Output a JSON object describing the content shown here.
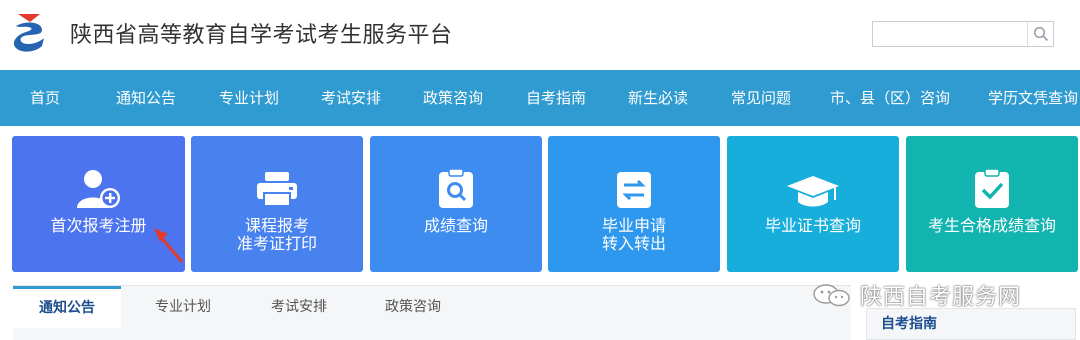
{
  "header": {
    "site_title": "陕西省高等教育自学考试考生服务平台",
    "search_placeholder": "",
    "search_icon": "search-icon"
  },
  "nav": {
    "items": [
      "首页",
      "通知公告",
      "专业计划",
      "考试安排",
      "政策咨询",
      "自考指南",
      "新生必读",
      "常见问题",
      "市、县（区）咨询",
      "学历文凭查询"
    ]
  },
  "tiles": [
    {
      "line1": "首次报考注册",
      "line2": "",
      "icon": "user-add-icon",
      "color": "#4d74ef"
    },
    {
      "line1": "课程报考",
      "line2": "准考证打印",
      "icon": "printer-icon",
      "color": "#4782ef"
    },
    {
      "line1": "成绩查询",
      "line2": "",
      "icon": "search-document-icon",
      "color": "#3f8cf0"
    },
    {
      "line1": "毕业申请",
      "line2": "转入转出",
      "icon": "transfer-icon",
      "color": "#2d98ee"
    },
    {
      "line1": "毕业证书查询",
      "line2": "",
      "icon": "graduation-cap-icon",
      "color": "#18aedb"
    },
    {
      "line1": "考生合格成绩查询",
      "line2": "",
      "icon": "check-clipboard-icon",
      "color": "#12b4b0"
    }
  ],
  "tabs": {
    "items": [
      "通知公告",
      "专业计划",
      "考试安排",
      "政策咨询"
    ],
    "active": "通知公告"
  },
  "sidebar": {
    "title": "自考指南"
  },
  "watermark": {
    "text": "陕西自考服务网"
  },
  "colors": {
    "nav_bg": "#2f9bd0",
    "accent_red": "#e23b2e",
    "text_dark": "#333333"
  }
}
